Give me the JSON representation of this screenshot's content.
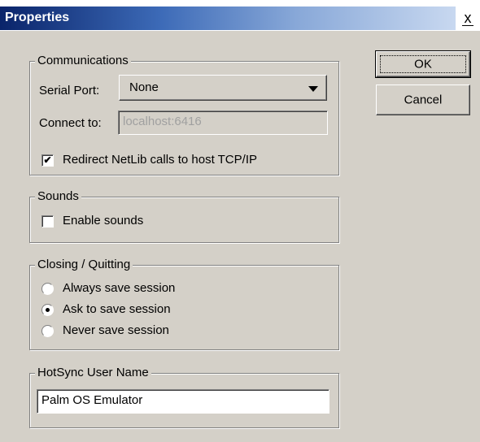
{
  "window": {
    "title": "Properties",
    "close_glyph": "x"
  },
  "buttons": {
    "ok": "OK",
    "cancel": "Cancel"
  },
  "communications": {
    "legend": "Communications",
    "serial_port_label": "Serial Port:",
    "serial_port_value": "None",
    "connect_to_label": "Connect to:",
    "connect_to_value": "localhost:6416",
    "redirect_label": "Redirect NetLib calls to host TCP/IP",
    "redirect_checked": true
  },
  "sounds": {
    "legend": "Sounds",
    "enable_label": "Enable sounds",
    "enable_checked": false
  },
  "closing": {
    "legend": "Closing / Quitting",
    "options": [
      {
        "label": "Always save session",
        "selected": false
      },
      {
        "label": "Ask to save session",
        "selected": true
      },
      {
        "label": "Never save session",
        "selected": false
      }
    ]
  },
  "hotsync": {
    "legend": "HotSync User Name",
    "value": "Palm OS Emulator"
  }
}
